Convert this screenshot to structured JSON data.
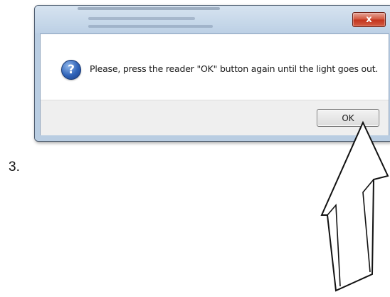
{
  "step": {
    "number": "3."
  },
  "dialog": {
    "close_label": "x",
    "icon": "question-icon",
    "message": "Please, press the reader \"OK\" button again until the light goes out.",
    "ok_label": "OK"
  },
  "annotation": {
    "icon": "arrow-up-icon",
    "pointing_to": "OK"
  },
  "colors": {
    "frame": "#b9cde2",
    "close_button": "#c2331d",
    "icon_blue": "#2f63b8",
    "button_bar": "#efefef"
  }
}
